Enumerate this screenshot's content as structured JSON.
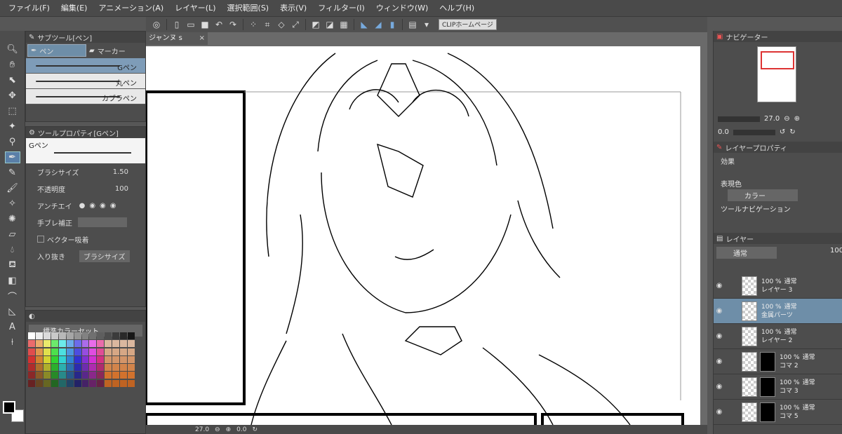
{
  "menu": [
    "ファイル(F)",
    "編集(E)",
    "アニメーション(A)",
    "レイヤー(L)",
    "選択範囲(S)",
    "表示(V)",
    "フィルター(I)",
    "ウィンドウ(W)",
    "ヘルプ(H)"
  ],
  "toolbar": {
    "clip_label": "CLIPホームページ"
  },
  "subtool": {
    "title": "サブツール[ペン]",
    "tab_pen": "ペン",
    "tab_marker": "マーカー",
    "brushes": [
      "Gペン",
      "丸ペン",
      "カブラペン"
    ]
  },
  "toolprop": {
    "title": "ツールプロパティ[Gペン]",
    "preview_label": "Gペン",
    "brush_size_label": "ブラシサイズ",
    "brush_size_value": "1.50",
    "opacity_label": "不透明度",
    "opacity_value": "100",
    "antialias_label": "アンチエイ",
    "stabilize_label": "手ブレ補正",
    "vector_label": "ベクター吸着",
    "taper_label": "入り抜き",
    "taper_value": "ブラシサイズ"
  },
  "color": {
    "set_label": "標準カラーセット"
  },
  "canvas": {
    "doc_tab": "ジャンヌ s",
    "zoom": "27.0",
    "angle": "0.0"
  },
  "navigator": {
    "title": "ナビゲーター",
    "zoom": "27.0",
    "angle": "0.0"
  },
  "layerprop": {
    "title": "レイヤープロパティ",
    "effect_label": "効果",
    "color_label": "表現色",
    "color_value": "カラー",
    "toolnav_label": "ツールナビゲーション"
  },
  "layers": {
    "title": "レイヤー",
    "blend": "通常",
    "opacity": "100",
    "items": [
      {
        "pct": "100 %",
        "mode": "通常",
        "name": "レイヤー 3"
      },
      {
        "pct": "100 %",
        "mode": "通常",
        "name": "金属パーツ"
      },
      {
        "pct": "100 %",
        "mode": "通常",
        "name": "レイヤー 2"
      },
      {
        "pct": "100 %",
        "mode": "通常",
        "name": "コマ 2"
      },
      {
        "pct": "100 %",
        "mode": "通常",
        "name": "コマ 3"
      },
      {
        "pct": "100 %",
        "mode": "通常",
        "name": "コマ 5"
      }
    ]
  }
}
